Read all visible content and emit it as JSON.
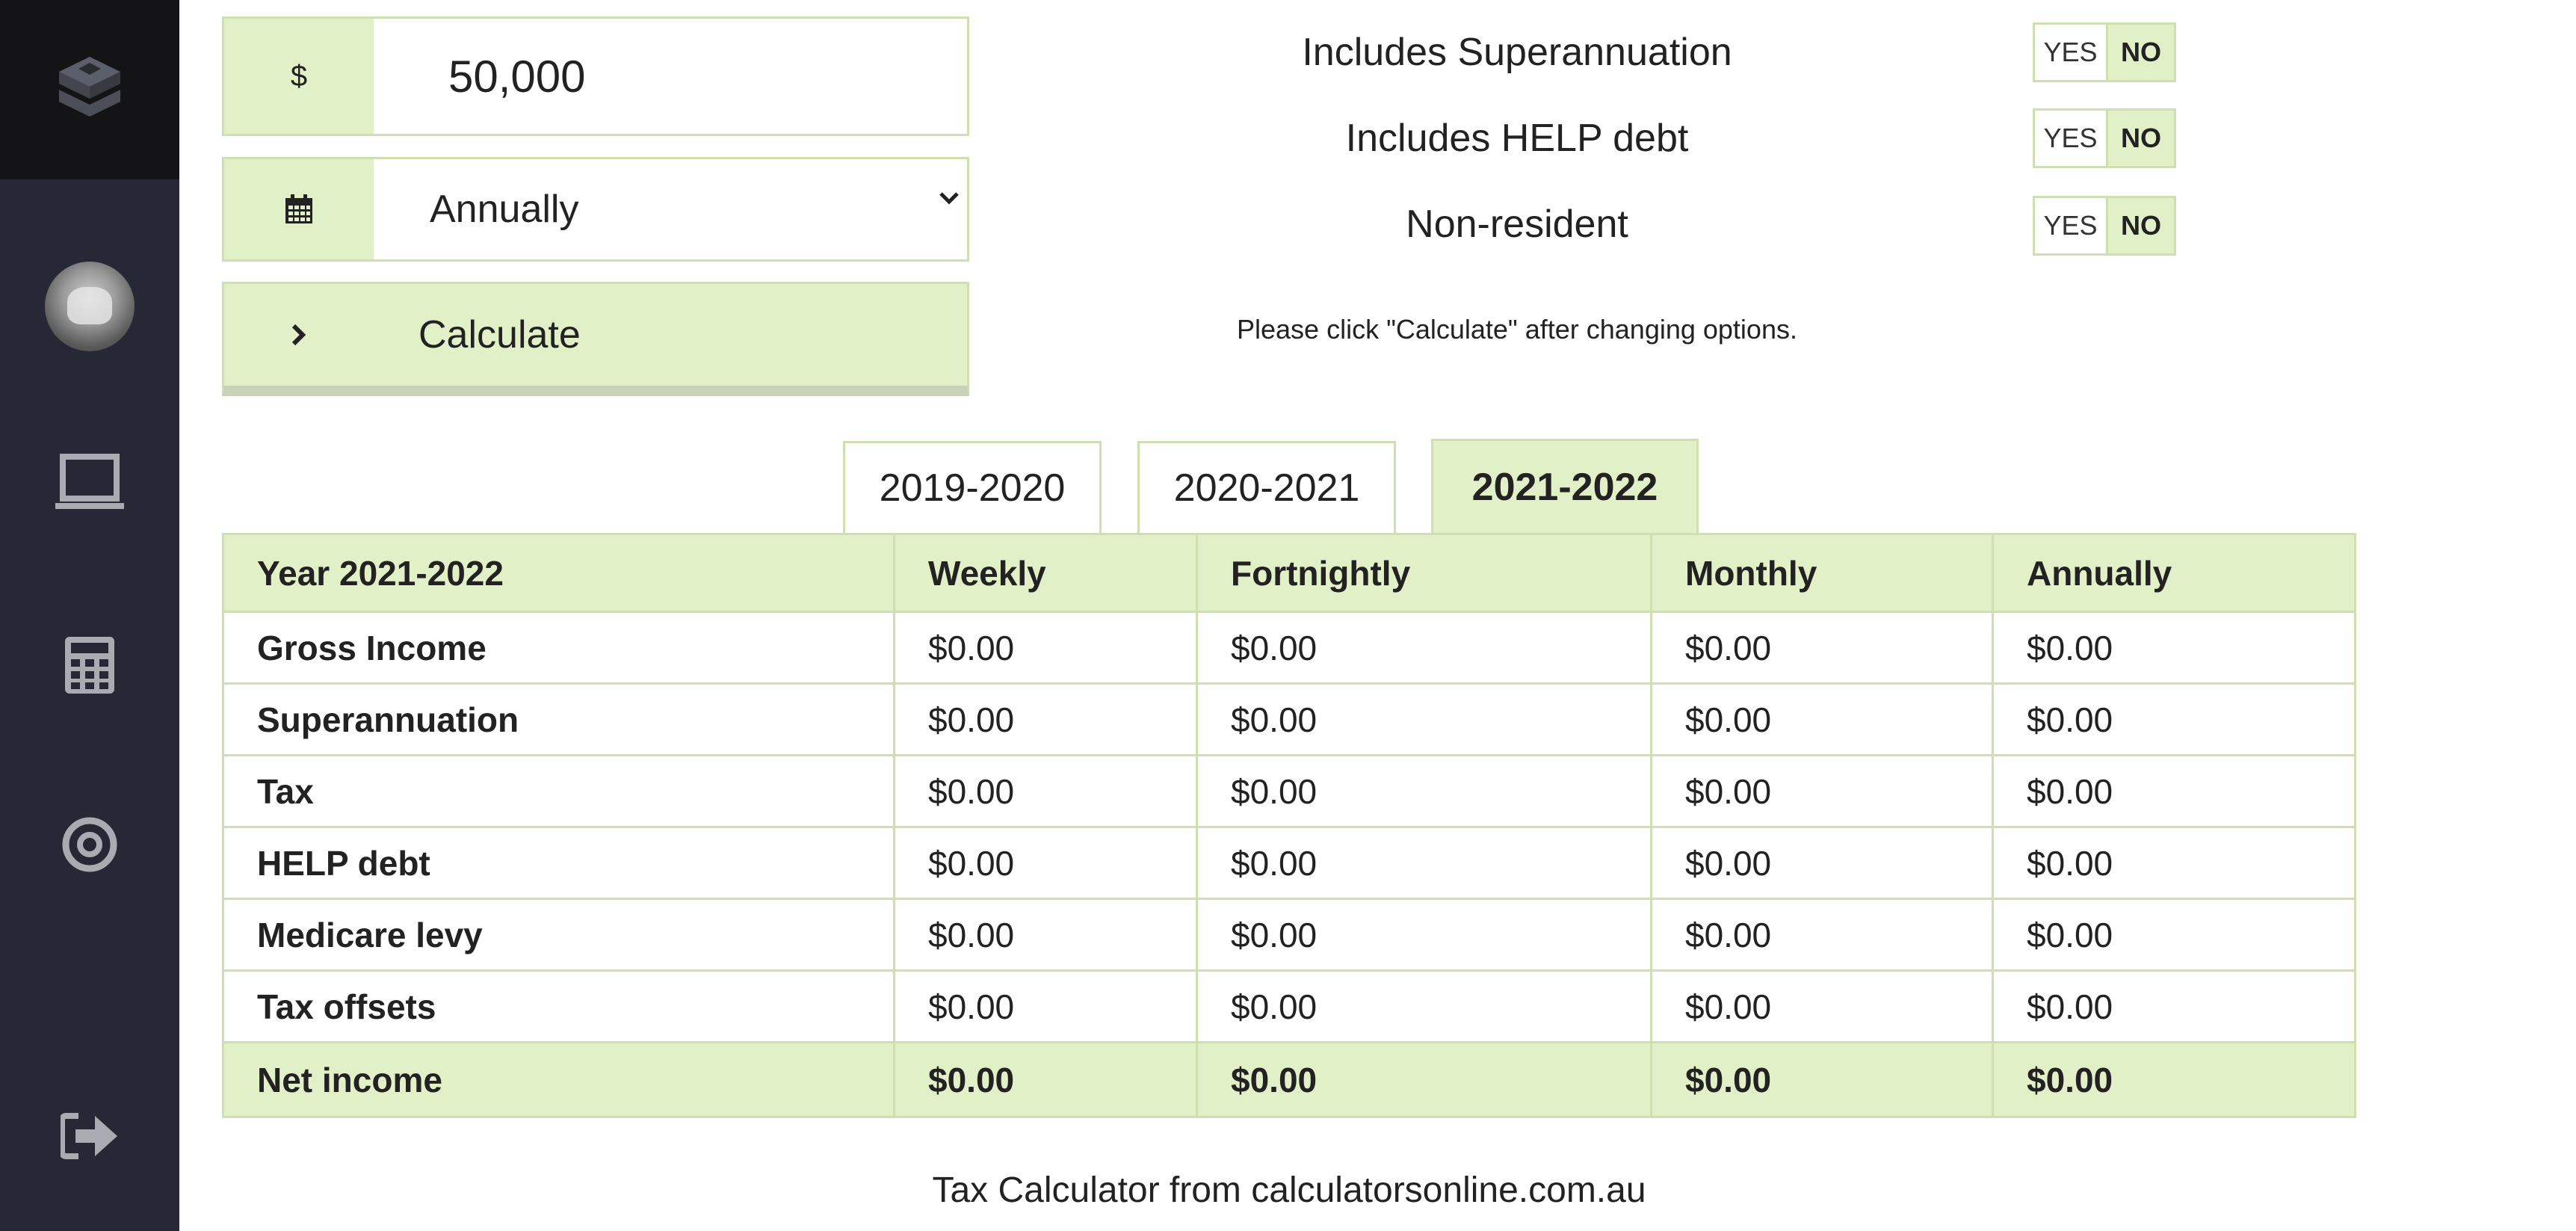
{
  "sidebar": {
    "items": [
      {
        "icon": "layers-logo-icon"
      },
      {
        "icon": "avatar"
      },
      {
        "icon": "laptop-icon"
      },
      {
        "icon": "calculator-icon"
      },
      {
        "icon": "target-icon"
      },
      {
        "icon": "logout-icon"
      }
    ]
  },
  "form": {
    "currency_symbol": "$",
    "amount_value": "50,000",
    "period_value": "Annually",
    "calculate_label": "Calculate"
  },
  "options": [
    {
      "label": "Includes Superannuation",
      "yes": "YES",
      "no": "NO",
      "selected": "NO"
    },
    {
      "label": "Includes HELP debt",
      "yes": "YES",
      "no": "NO",
      "selected": "NO"
    },
    {
      "label": "Non-resident",
      "yes": "YES",
      "no": "NO",
      "selected": "NO"
    }
  ],
  "hint": "Please click \"Calculate\" after changing options.",
  "tabs": [
    {
      "label": "2019-2020",
      "active": false
    },
    {
      "label": "2020-2021",
      "active": false
    },
    {
      "label": "2021-2022",
      "active": true
    }
  ],
  "table": {
    "headers": [
      "Year 2021-2022",
      "Weekly",
      "Fortnightly",
      "Monthly",
      "Annually"
    ],
    "rows": [
      {
        "label": "Gross Income",
        "values": [
          "$0.00",
          "$0.00",
          "$0.00",
          "$0.00"
        ]
      },
      {
        "label": "Superannuation",
        "values": [
          "$0.00",
          "$0.00",
          "$0.00",
          "$0.00"
        ]
      },
      {
        "label": "Tax",
        "values": [
          "$0.00",
          "$0.00",
          "$0.00",
          "$0.00"
        ]
      },
      {
        "label": "HELP debt",
        "values": [
          "$0.00",
          "$0.00",
          "$0.00",
          "$0.00"
        ]
      },
      {
        "label": "Medicare levy",
        "values": [
          "$0.00",
          "$0.00",
          "$0.00",
          "$0.00"
        ]
      },
      {
        "label": "Tax offsets",
        "values": [
          "$0.00",
          "$0.00",
          "$0.00",
          "$0.00"
        ]
      }
    ],
    "total": {
      "label": "Net income",
      "values": [
        "$0.00",
        "$0.00",
        "$0.00",
        "$0.00"
      ]
    }
  },
  "footer": "Tax Calculator from calculatorsonline.com.au",
  "colors": {
    "sidebar_bg": "#262836",
    "logo_bg": "#141417",
    "accent_green": "#e2f0c8",
    "border_green": "#cfe0b0"
  }
}
